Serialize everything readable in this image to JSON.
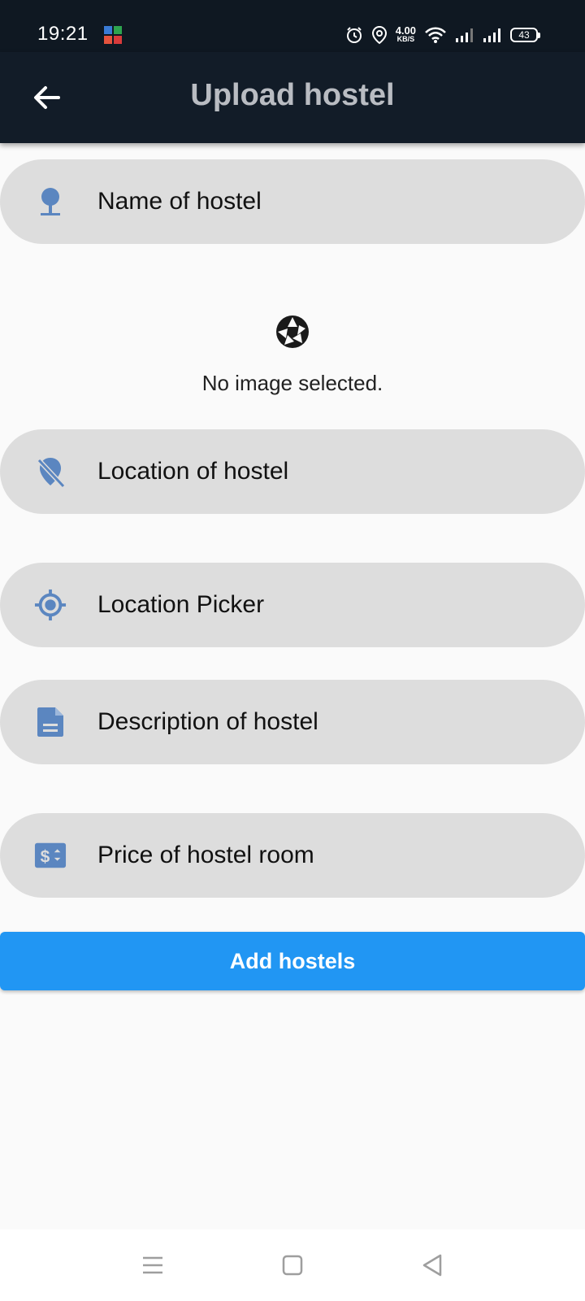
{
  "status_bar": {
    "time": "19:21",
    "speed_value": "4.00",
    "speed_unit": "KB/S",
    "battery": "43"
  },
  "app_bar": {
    "title": "Upload hostel"
  },
  "form": {
    "name_placeholder": "Name of hostel",
    "no_image_text": "No image selected.",
    "location_placeholder": "Location of hostel",
    "location_picker_label": "Location Picker",
    "description_placeholder": "Description of hostel",
    "price_placeholder": "Price of hostel room",
    "submit_label": "Add hostels"
  },
  "colors": {
    "icon_blue": "#5b86c0",
    "button_blue": "#2196f3",
    "field_bg": "#dddddd",
    "app_bar_bg": "#121c28"
  }
}
